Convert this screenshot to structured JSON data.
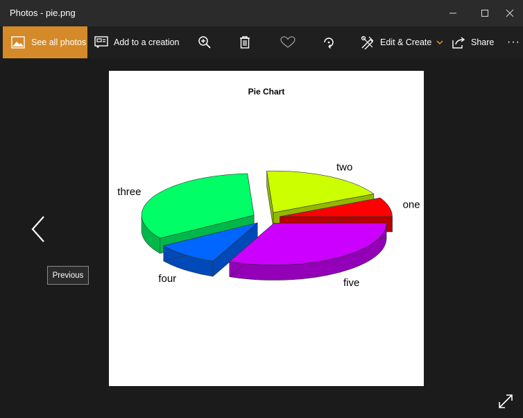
{
  "window": {
    "title": "Photos - pie.png"
  },
  "toolbar": {
    "see_all_photos": "See all photos",
    "add_to_creation": "Add to a creation",
    "edit_create": "Edit & Create",
    "share": "Share",
    "more": "···"
  },
  "tooltip": {
    "previous": "Previous"
  },
  "colors": {
    "accent": "#d48a28",
    "titlebar": "#2b2b2b",
    "background": "#1b1b1b"
  },
  "icons": [
    "photos-icon",
    "add-to-creation-icon",
    "zoom-in-icon",
    "delete-icon",
    "favorite-icon",
    "rotate-icon",
    "edit-create-icon",
    "share-icon",
    "more-icon",
    "minimize-icon",
    "maximize-icon",
    "close-icon",
    "previous-arrow-icon",
    "fullscreen-icon"
  ],
  "chart_data": {
    "type": "pie",
    "title": "Pie Chart",
    "style": "3d exploded",
    "slices": [
      {
        "label": "one",
        "value": 4,
        "color": "#ff0000"
      },
      {
        "label": "two",
        "value": 10,
        "color": "#ccff00"
      },
      {
        "label": "three",
        "value": 18,
        "color": "#00ff66"
      },
      {
        "label": "four",
        "value": 5,
        "color": "#0066ff"
      },
      {
        "label": "five",
        "value": 17,
        "color": "#cc00ff"
      }
    ]
  }
}
